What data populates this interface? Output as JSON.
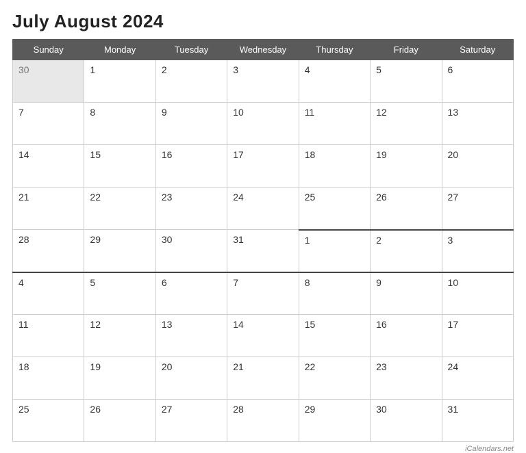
{
  "title": "July August 2024",
  "watermark": "iCalendars.net",
  "headers": [
    "Sunday",
    "Monday",
    "Tuesday",
    "Wednesday",
    "Thursday",
    "Friday",
    "Saturday"
  ],
  "weeks": [
    [
      {
        "day": "30",
        "greyed": true
      },
      {
        "day": "1",
        "greyed": false
      },
      {
        "day": "2",
        "greyed": false
      },
      {
        "day": "3",
        "greyed": false
      },
      {
        "day": "4",
        "greyed": false
      },
      {
        "day": "5",
        "greyed": false
      },
      {
        "day": "6",
        "greyed": false
      }
    ],
    [
      {
        "day": "7",
        "greyed": false
      },
      {
        "day": "8",
        "greyed": false
      },
      {
        "day": "9",
        "greyed": false
      },
      {
        "day": "10",
        "greyed": false
      },
      {
        "day": "11",
        "greyed": false
      },
      {
        "day": "12",
        "greyed": false
      },
      {
        "day": "13",
        "greyed": false
      }
    ],
    [
      {
        "day": "14",
        "greyed": false
      },
      {
        "day": "15",
        "greyed": false
      },
      {
        "day": "16",
        "greyed": false
      },
      {
        "day": "17",
        "greyed": false
      },
      {
        "day": "18",
        "greyed": false
      },
      {
        "day": "19",
        "greyed": false
      },
      {
        "day": "20",
        "greyed": false
      }
    ],
    [
      {
        "day": "21",
        "greyed": false
      },
      {
        "day": "22",
        "greyed": false
      },
      {
        "day": "23",
        "greyed": false
      },
      {
        "day": "24",
        "greyed": false
      },
      {
        "day": "25",
        "greyed": false
      },
      {
        "day": "26",
        "greyed": false
      },
      {
        "day": "27",
        "greyed": false
      }
    ],
    [
      {
        "day": "28",
        "greyed": false
      },
      {
        "day": "29",
        "greyed": false
      },
      {
        "day": "30",
        "greyed": false
      },
      {
        "day": "31",
        "greyed": false
      },
      {
        "day": "1",
        "greyed": false,
        "month_divider": true
      },
      {
        "day": "2",
        "greyed": false,
        "month_divider": true
      },
      {
        "day": "3",
        "greyed": false,
        "month_divider": true
      }
    ],
    [
      {
        "day": "4",
        "greyed": false,
        "month_divider": true
      },
      {
        "day": "5",
        "greyed": false,
        "month_divider": true
      },
      {
        "day": "6",
        "greyed": false,
        "month_divider": true
      },
      {
        "day": "7",
        "greyed": false,
        "month_divider": true
      },
      {
        "day": "8",
        "greyed": false,
        "month_divider": true
      },
      {
        "day": "9",
        "greyed": false,
        "month_divider": true
      },
      {
        "day": "10",
        "greyed": false,
        "month_divider": true
      }
    ],
    [
      {
        "day": "11",
        "greyed": false
      },
      {
        "day": "12",
        "greyed": false
      },
      {
        "day": "13",
        "greyed": false
      },
      {
        "day": "14",
        "greyed": false
      },
      {
        "day": "15",
        "greyed": false
      },
      {
        "day": "16",
        "greyed": false
      },
      {
        "day": "17",
        "greyed": false
      }
    ],
    [
      {
        "day": "18",
        "greyed": false
      },
      {
        "day": "19",
        "greyed": false
      },
      {
        "day": "20",
        "greyed": false
      },
      {
        "day": "21",
        "greyed": false
      },
      {
        "day": "22",
        "greyed": false
      },
      {
        "day": "23",
        "greyed": false
      },
      {
        "day": "24",
        "greyed": false
      }
    ],
    [
      {
        "day": "25",
        "greyed": false
      },
      {
        "day": "26",
        "greyed": false
      },
      {
        "day": "27",
        "greyed": false
      },
      {
        "day": "28",
        "greyed": false
      },
      {
        "day": "29",
        "greyed": false
      },
      {
        "day": "30",
        "greyed": false
      },
      {
        "day": "31",
        "greyed": false
      }
    ]
  ]
}
